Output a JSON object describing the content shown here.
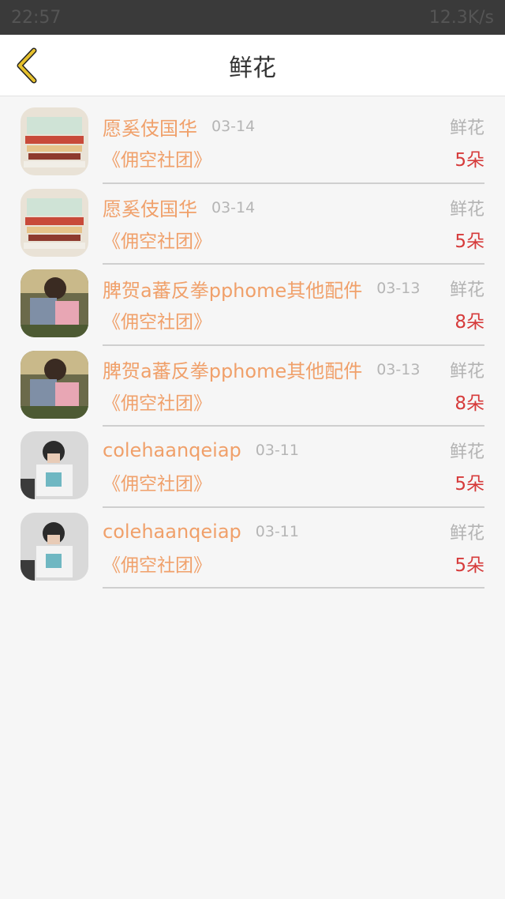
{
  "statusbar": {
    "time": "22:57",
    "battery": "12.3K/s"
  },
  "navbar": {
    "title": "鲜花"
  },
  "records": [
    {
      "avatar": "book-stack",
      "name": "愿奚伎国华",
      "date": "03-14",
      "type": "鲜花",
      "club": "《佣空社团》",
      "count": "5朵"
    },
    {
      "avatar": "book-stack",
      "name": "愿奚伎国华",
      "date": "03-14",
      "type": "鲜花",
      "club": "《佣空社团》",
      "count": "5朵"
    },
    {
      "avatar": "couple-photo",
      "name": "脾贺a蕃反拳pphome其他配件",
      "date": "03-13",
      "type": "鲜花",
      "club": "《佣空社团》",
      "count": "8朵"
    },
    {
      "avatar": "couple-photo",
      "name": "脾贺a蕃反拳pphome其他配件",
      "date": "03-13",
      "type": "鲜花",
      "club": "《佣空社团》",
      "count": "8朵"
    },
    {
      "avatar": "boy-selfie",
      "name": "colehaanqeiap",
      "date": "03-11",
      "type": "鲜花",
      "club": "《佣空社团》",
      "count": "5朵"
    },
    {
      "avatar": "boy-selfie",
      "name": "colehaanqeiap",
      "date": "03-11",
      "type": "鲜花",
      "club": "《佣空社团》",
      "count": "5朵"
    }
  ],
  "colors": {
    "accent": "#f0a06a",
    "count": "#d63b3b",
    "back_arrow": "#e6c12e"
  }
}
